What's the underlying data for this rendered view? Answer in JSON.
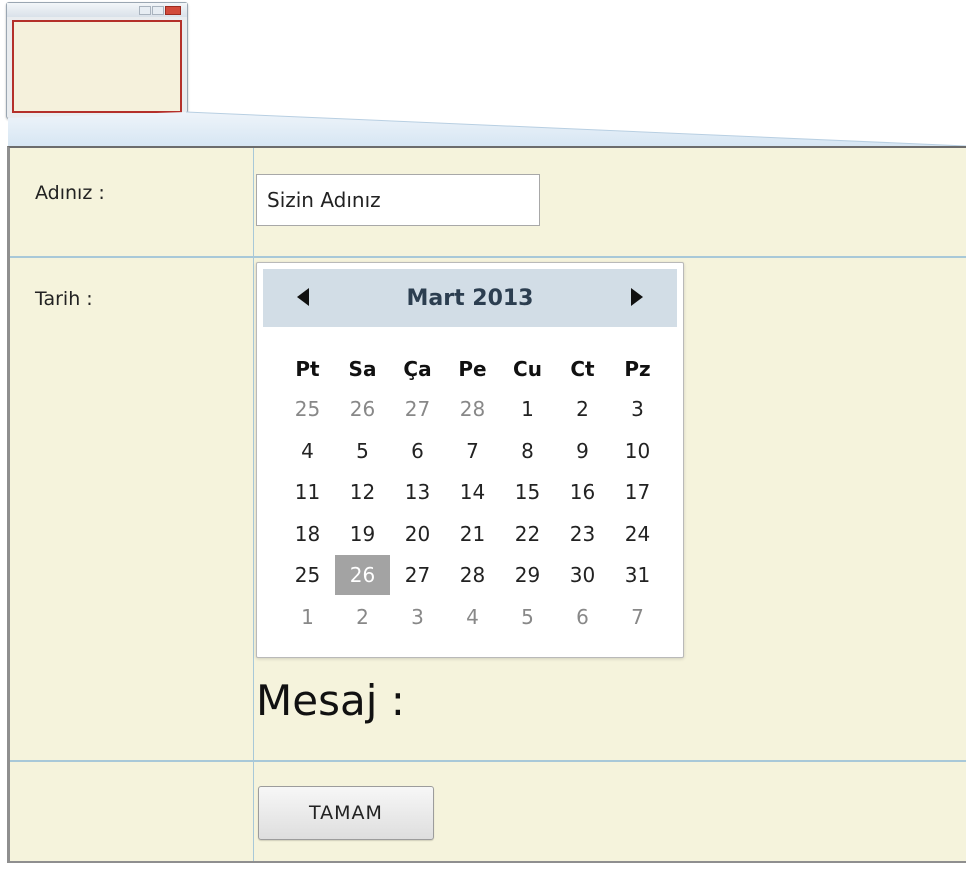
{
  "form": {
    "name_label": "Adınız :",
    "name_value": "Sizin Adınız",
    "date_label": "Tarih :",
    "message_label": "Mesaj :",
    "ok_button": "TAMAM"
  },
  "calendar": {
    "month_title": "Mart 2013",
    "weekdays": [
      "Pt",
      "Sa",
      "Ça",
      "Pe",
      "Cu",
      "Ct",
      "Pz"
    ],
    "weeks": [
      [
        {
          "d": "25",
          "muted": true
        },
        {
          "d": "26",
          "muted": true
        },
        {
          "d": "27",
          "muted": true
        },
        {
          "d": "28",
          "muted": true
        },
        {
          "d": "1"
        },
        {
          "d": "2"
        },
        {
          "d": "3"
        }
      ],
      [
        {
          "d": "4"
        },
        {
          "d": "5"
        },
        {
          "d": "6"
        },
        {
          "d": "7"
        },
        {
          "d": "8"
        },
        {
          "d": "9"
        },
        {
          "d": "10"
        }
      ],
      [
        {
          "d": "11"
        },
        {
          "d": "12"
        },
        {
          "d": "13"
        },
        {
          "d": "14"
        },
        {
          "d": "15"
        },
        {
          "d": "16"
        },
        {
          "d": "17"
        }
      ],
      [
        {
          "d": "18"
        },
        {
          "d": "19"
        },
        {
          "d": "20"
        },
        {
          "d": "21"
        },
        {
          "d": "22"
        },
        {
          "d": "23"
        },
        {
          "d": "24"
        }
      ],
      [
        {
          "d": "25"
        },
        {
          "d": "26",
          "selected": true
        },
        {
          "d": "27"
        },
        {
          "d": "28"
        },
        {
          "d": "29"
        },
        {
          "d": "30"
        },
        {
          "d": "31"
        }
      ],
      [
        {
          "d": "1",
          "muted": true
        },
        {
          "d": "2",
          "muted": true
        },
        {
          "d": "3",
          "muted": true
        },
        {
          "d": "4",
          "muted": true
        },
        {
          "d": "5",
          "muted": true
        },
        {
          "d": "6",
          "muted": true
        },
        {
          "d": "7",
          "muted": true
        }
      ]
    ],
    "selected_day": "26",
    "prev_icon": "triangle-left-icon",
    "next_icon": "triangle-right-icon"
  },
  "colors": {
    "form_background": "#f5f3dc",
    "grid_lines": "#a8c8d8",
    "calendar_header": "#d2dde6",
    "selected_day": "#a3a3a3",
    "thumbnail_border": "#b4302a"
  }
}
